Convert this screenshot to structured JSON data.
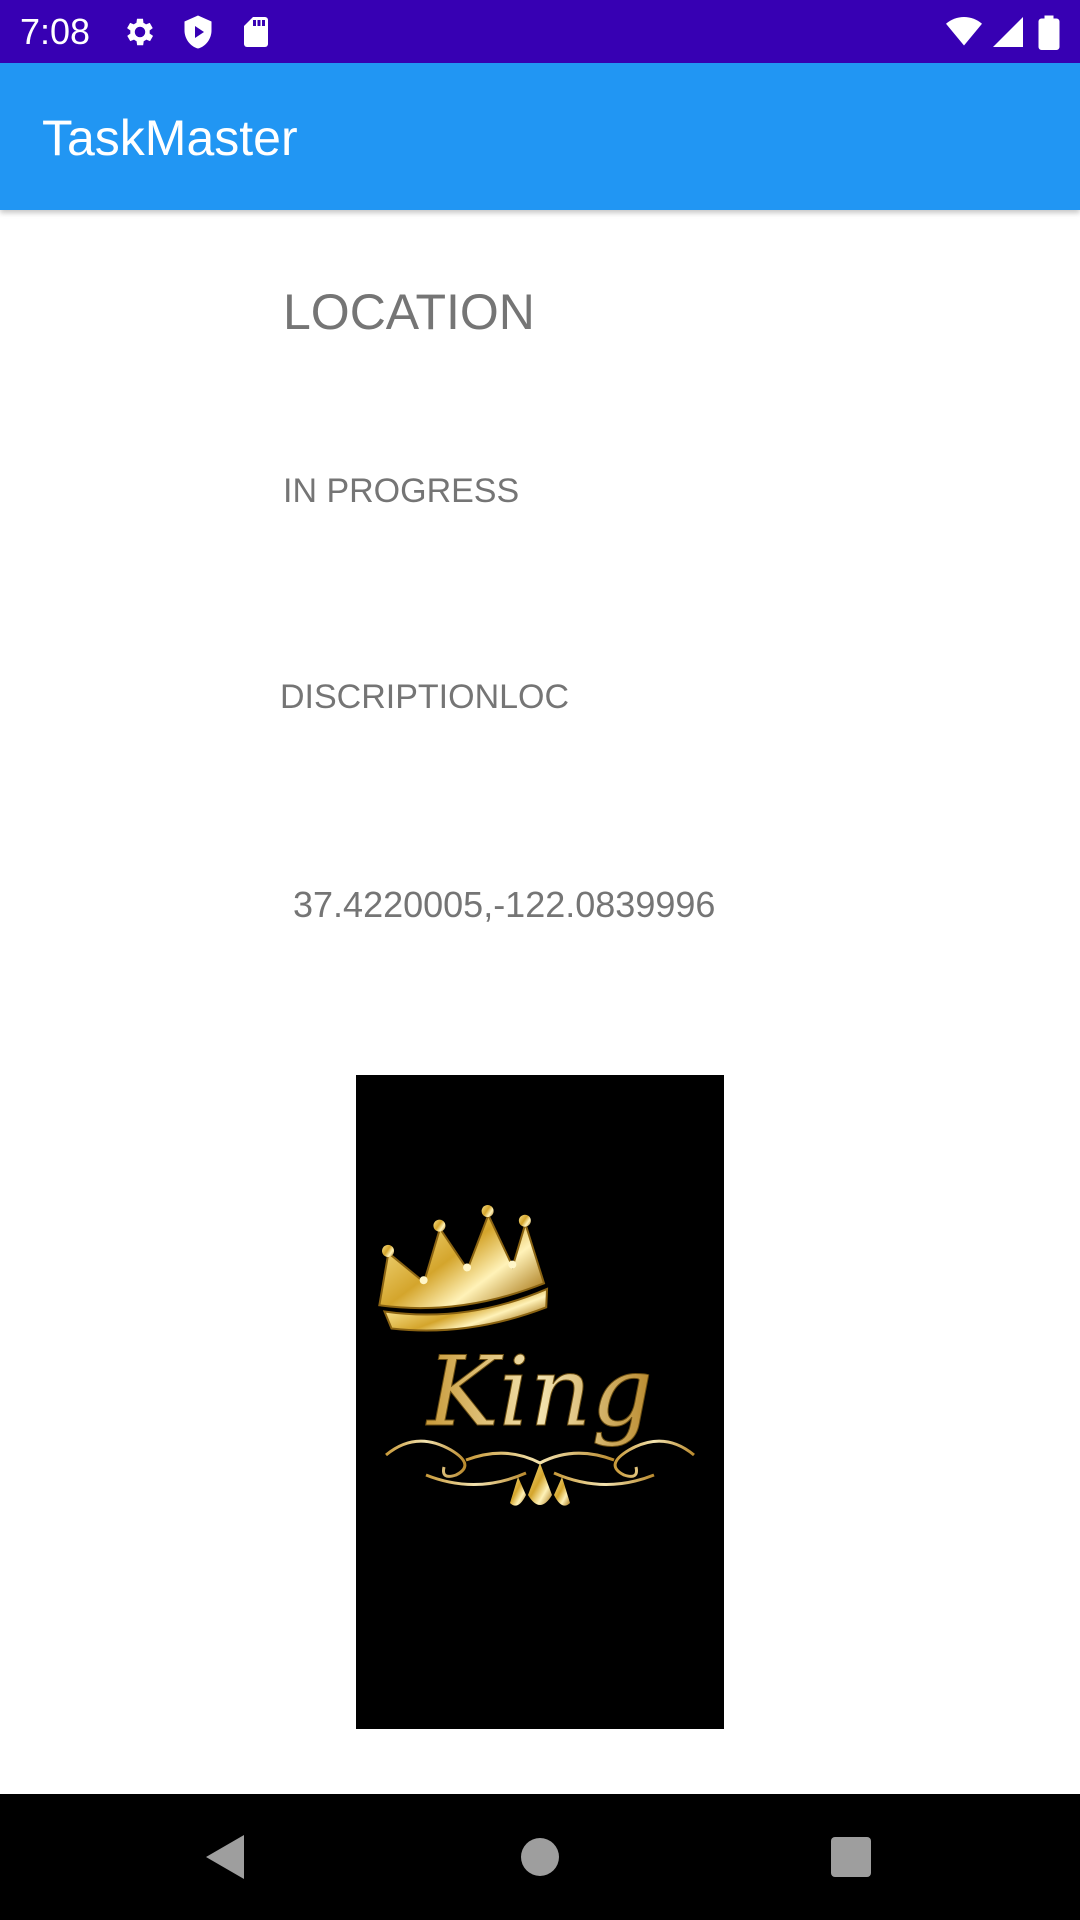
{
  "status_bar": {
    "time": "7:08",
    "background": "#3700b3",
    "left_icons": [
      "gear-icon",
      "shield-play-icon",
      "sd-card-icon"
    ],
    "right_icons": [
      "wifi-icon",
      "cell-signal-icon",
      "battery-icon"
    ]
  },
  "app_bar": {
    "title": "TaskMaster",
    "background": "#2196f3"
  },
  "task": {
    "title": "LOCATION",
    "status": "IN PROGRESS",
    "description": "DISCRIPTIONLOC",
    "location": "37.4220005,-122.0839996",
    "image": {
      "text": "King",
      "icon": "crown-icon"
    }
  },
  "nav_bar": {
    "buttons": [
      "back-icon",
      "home-icon",
      "recents-icon"
    ]
  }
}
